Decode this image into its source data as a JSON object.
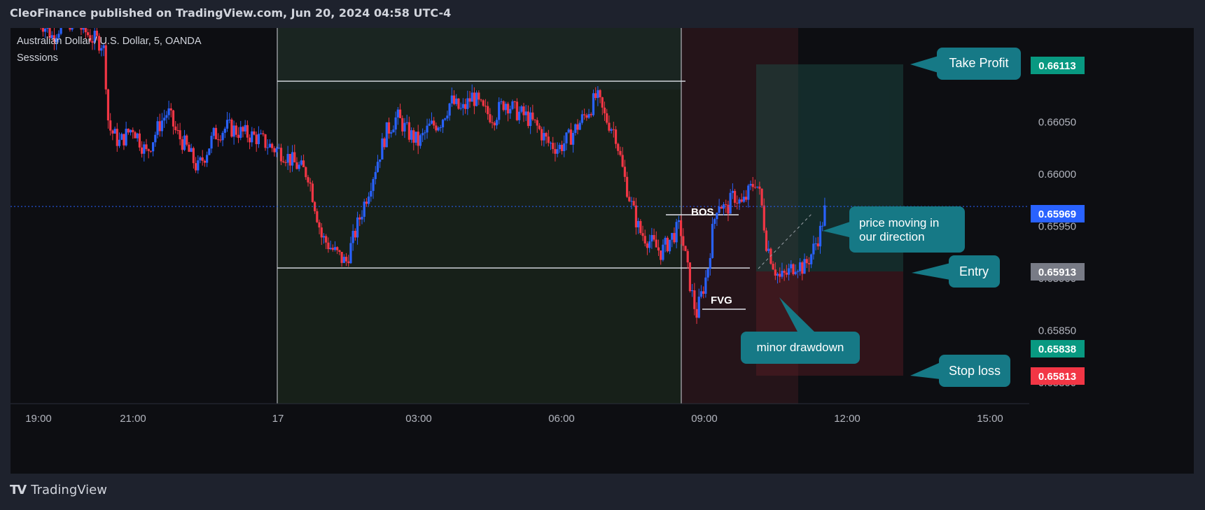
{
  "header": {
    "published": "CleoFinance published on TradingView.com, Jun 20, 2024 04:58 UTC-4"
  },
  "footer": {
    "brand": "TradingView",
    "logo_icon": "tradingview-logo-icon"
  },
  "colors": {
    "bull": "#2962ff",
    "bear": "#f23645",
    "price_line": "#2962ff",
    "callout": "#167986",
    "tp_badge": "#089981",
    "entry_badge": "#787b86",
    "sl_badge": "#f23645"
  },
  "chart_data": {
    "type": "candlestick",
    "title": "Australian Dollar / U.S. Dollar, 5, OANDA",
    "indicator": "Sessions",
    "x_ticks": [
      "19:00",
      "21:00",
      "17",
      "03:00",
      "06:00",
      "09:00",
      "12:00",
      "15:00"
    ],
    "y_ticks": [
      "0.66100",
      "0.66050",
      "0.66000",
      "0.65950",
      "0.65900",
      "0.65850",
      "0.65800"
    ],
    "ylim": [
      0.6578,
      0.6614
    ],
    "grid": false,
    "current_price": "0.65969",
    "position": {
      "take_profit": "0.66113",
      "entry": "0.65913",
      "stop_loss": "0.65813"
    },
    "extra_badge": "0.65838",
    "levels": {
      "range_high": 0.66089,
      "range_low": 0.6591,
      "bos": 0.65961
    },
    "close_path": [
      [
        18.5,
        0.6615
      ],
      [
        19.0,
        0.66132
      ],
      [
        19.5,
        0.66148
      ],
      [
        20.0,
        0.66142
      ],
      [
        20.5,
        0.6613
      ],
      [
        20.9,
        0.66125
      ],
      [
        21.0,
        0.6609
      ],
      [
        21.1,
        0.66045
      ],
      [
        21.5,
        0.6603
      ],
      [
        22.0,
        0.66045
      ],
      [
        22.5,
        0.6602
      ],
      [
        23.0,
        0.66048
      ],
      [
        23.3,
        0.6606
      ],
      [
        23.6,
        0.6604
      ],
      [
        24.0,
        0.66025
      ],
      [
        24.4,
        0.66005
      ],
      [
        24.7,
        0.6602
      ],
      [
        25.0,
        0.66037
      ],
      [
        25.5,
        0.66045
      ],
      [
        26.0,
        0.6604
      ],
      [
        26.6,
        0.66035
      ],
      [
        27.2,
        0.66025
      ],
      [
        27.6,
        0.6602
      ],
      [
        28.0,
        0.6601
      ],
      [
        28.5,
        0.66
      ],
      [
        28.8,
        0.65965
      ],
      [
        29.0,
        0.6594
      ],
      [
        29.5,
        0.65925
      ],
      [
        29.9,
        0.65915
      ],
      [
        30.2,
        0.6594
      ],
      [
        30.5,
        0.65965
      ],
      [
        30.8,
        0.6599
      ],
      [
        31.1,
        0.66015
      ],
      [
        31.4,
        0.6604
      ],
      [
        31.8,
        0.66055
      ],
      [
        32.2,
        0.6604
      ],
      [
        32.6,
        0.6603
      ],
      [
        33.0,
        0.66045
      ],
      [
        33.4,
        0.6605
      ],
      [
        33.8,
        0.6607
      ],
      [
        34.2,
        0.6606
      ],
      [
        34.6,
        0.66075
      ],
      [
        35.0,
        0.6606
      ],
      [
        35.4,
        0.66055
      ],
      [
        35.8,
        0.6607
      ],
      [
        36.2,
        0.6606
      ],
      [
        36.6,
        0.66055
      ],
      [
        37.0,
        0.66045
      ],
      [
        37.4,
        0.6603
      ],
      [
        37.8,
        0.66025
      ],
      [
        38.2,
        0.66035
      ],
      [
        38.6,
        0.6605
      ],
      [
        39.0,
        0.66065
      ],
      [
        39.2,
        0.66075
      ],
      [
        39.5,
        0.66055
      ],
      [
        39.9,
        0.6604
      ],
      [
        40.2,
        0.66
      ],
      [
        40.5,
        0.6597
      ],
      [
        40.8,
        0.65945
      ],
      [
        41.2,
        0.65935
      ],
      [
        41.6,
        0.65925
      ],
      [
        42.0,
        0.6594
      ],
      [
        42.3,
        0.6595
      ],
      [
        42.5,
        0.6592
      ],
      [
        42.7,
        0.6589
      ],
      [
        42.9,
        0.65865
      ],
      [
        43.1,
        0.65885
      ],
      [
        43.3,
        0.65905
      ],
      [
        43.5,
        0.65945
      ],
      [
        43.7,
        0.65975
      ],
      [
        44.0,
        0.65965
      ],
      [
        44.3,
        0.6598
      ],
      [
        44.6,
        0.6597
      ],
      [
        44.9,
        0.65985
      ],
      [
        45.1,
        0.65995
      ],
      [
        45.3,
        0.65975
      ],
      [
        45.5,
        0.65935
      ],
      [
        45.8,
        0.6591
      ],
      [
        46.0,
        0.659
      ],
      [
        46.3,
        0.65905
      ],
      [
        46.6,
        0.65915
      ],
      [
        46.9,
        0.6591
      ],
      [
        47.2,
        0.65925
      ],
      [
        47.5,
        0.65945
      ],
      [
        47.7,
        0.65969
      ]
    ],
    "annotations": [
      "Take Profit",
      "Entry",
      "Stop loss",
      "minor drawdown",
      "price moving in our direction",
      "BOS",
      "FVG"
    ]
  }
}
